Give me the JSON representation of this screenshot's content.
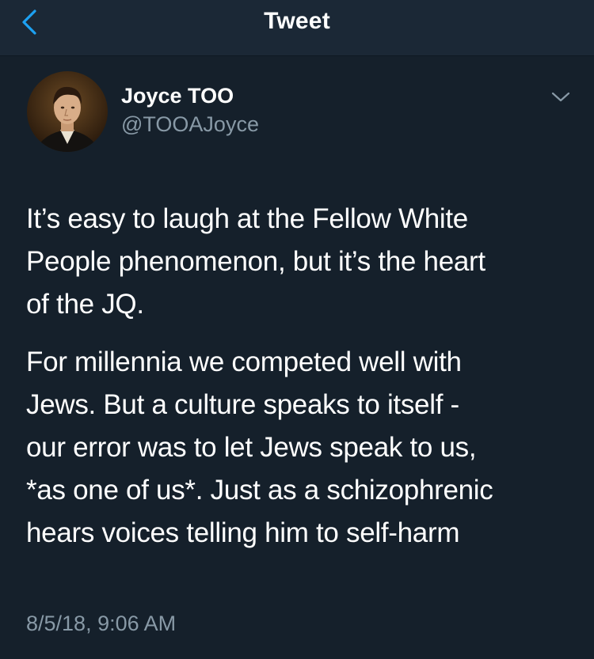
{
  "header": {
    "title": "Tweet",
    "back_icon": "chevron-left-icon",
    "accent_color": "#1da1f2"
  },
  "tweet": {
    "author": {
      "display_name": "Joyce TOO",
      "handle": "@TOOAJoyce"
    },
    "menu_icon": "chevron-down-icon",
    "paragraphs": [
      [
        "It’s easy to laugh at the Fellow White",
        "People phenomenon, but it’s the heart",
        "of the JQ."
      ],
      [
        "For millennia we competed well with",
        "Jews. But a culture speaks to itself -",
        "our error was to let Jews speak to us,",
        "*as one of us*. Just as a schizophrenic",
        "hears voices telling him to self-harm"
      ]
    ],
    "timestamp": "8/5/18, 9:06 AM"
  },
  "colors": {
    "background": "#15202b",
    "navbar": "#1b2836",
    "secondary_text": "#8899a6"
  }
}
